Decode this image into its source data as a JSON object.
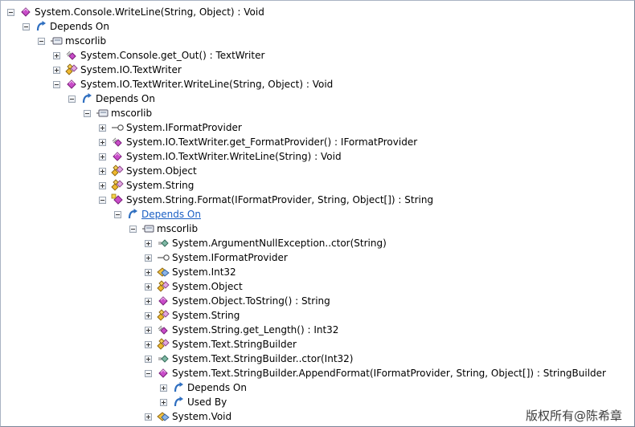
{
  "tree": {
    "rows": [
      {
        "label": "System.Console.WriteLine(String, Object) : Void",
        "toggle": "minus",
        "icon": "method-icon",
        "link": false
      },
      {
        "label": "Depends On",
        "toggle": "minus",
        "icon": "dependency-arrow-icon",
        "link": false
      },
      {
        "label": "mscorlib",
        "toggle": "minus",
        "icon": "assembly-icon",
        "link": false
      },
      {
        "label": "System.Console.get_Out() : TextWriter",
        "toggle": "plus",
        "icon": "property-method-icon",
        "link": false
      },
      {
        "label": "System.IO.TextWriter",
        "toggle": "plus",
        "icon": "class-icon",
        "link": false
      },
      {
        "label": "System.IO.TextWriter.WriteLine(String, Object) : Void",
        "toggle": "minus",
        "icon": "method-icon",
        "link": false
      },
      {
        "label": "Depends On",
        "toggle": "minus",
        "icon": "dependency-arrow-icon",
        "link": false
      },
      {
        "label": "mscorlib",
        "toggle": "minus",
        "icon": "assembly-icon",
        "link": false
      },
      {
        "label": "System.IFormatProvider",
        "toggle": "plus",
        "icon": "interface-icon",
        "link": false
      },
      {
        "label": "System.IO.TextWriter.get_FormatProvider() : IFormatProvider",
        "toggle": "plus",
        "icon": "property-method-icon",
        "link": false
      },
      {
        "label": "System.IO.TextWriter.WriteLine(String) : Void",
        "toggle": "plus",
        "icon": "method-icon",
        "link": false
      },
      {
        "label": "System.Object",
        "toggle": "plus",
        "icon": "class-icon",
        "link": false
      },
      {
        "label": "System.String",
        "toggle": "plus",
        "icon": "class-icon",
        "link": false
      },
      {
        "label": "System.String.Format(IFormatProvider, String, Object[]) : String",
        "toggle": "minus",
        "icon": "static-method-icon",
        "link": false
      },
      {
        "label": "Depends On",
        "toggle": "minus",
        "icon": "dependency-arrow-icon",
        "link": true
      },
      {
        "label": "mscorlib",
        "toggle": "minus",
        "icon": "assembly-icon",
        "link": false
      },
      {
        "label": "System.ArgumentNullException..ctor(String)",
        "toggle": "plus",
        "icon": "constructor-icon",
        "link": false
      },
      {
        "label": "System.IFormatProvider",
        "toggle": "plus",
        "icon": "interface-icon",
        "link": false
      },
      {
        "label": "System.Int32",
        "toggle": "plus",
        "icon": "struct-icon",
        "link": false
      },
      {
        "label": "System.Object",
        "toggle": "plus",
        "icon": "class-icon",
        "link": false
      },
      {
        "label": "System.Object.ToString() : String",
        "toggle": "plus",
        "icon": "method-icon",
        "link": false
      },
      {
        "label": "System.String",
        "toggle": "plus",
        "icon": "class-icon",
        "link": false
      },
      {
        "label": "System.String.get_Length() : Int32",
        "toggle": "plus",
        "icon": "property-method-icon",
        "link": false
      },
      {
        "label": "System.Text.StringBuilder",
        "toggle": "plus",
        "icon": "class-icon",
        "link": false
      },
      {
        "label": "System.Text.StringBuilder..ctor(Int32)",
        "toggle": "plus",
        "icon": "constructor-icon",
        "link": false
      },
      {
        "label": "System.Text.StringBuilder.AppendFormat(IFormatProvider, String, Object[]) : StringBuilder",
        "toggle": "minus",
        "icon": "method-icon",
        "link": false
      },
      {
        "label": "Depends On",
        "toggle": "plus",
        "icon": "dependency-arrow-icon",
        "link": false
      },
      {
        "label": "Used By",
        "toggle": "plus",
        "icon": "dependency-arrow-icon",
        "link": false
      },
      {
        "label": "System.Void",
        "toggle": "plus",
        "icon": "struct-icon",
        "link": false
      }
    ]
  },
  "watermark": "版权所有@陈希章",
  "colors": {
    "link": "#1a5fc4",
    "method": "#c23ec2",
    "class": "#e0b030",
    "struct": "#4a7fd0",
    "dependency": "#2f6fc0"
  }
}
